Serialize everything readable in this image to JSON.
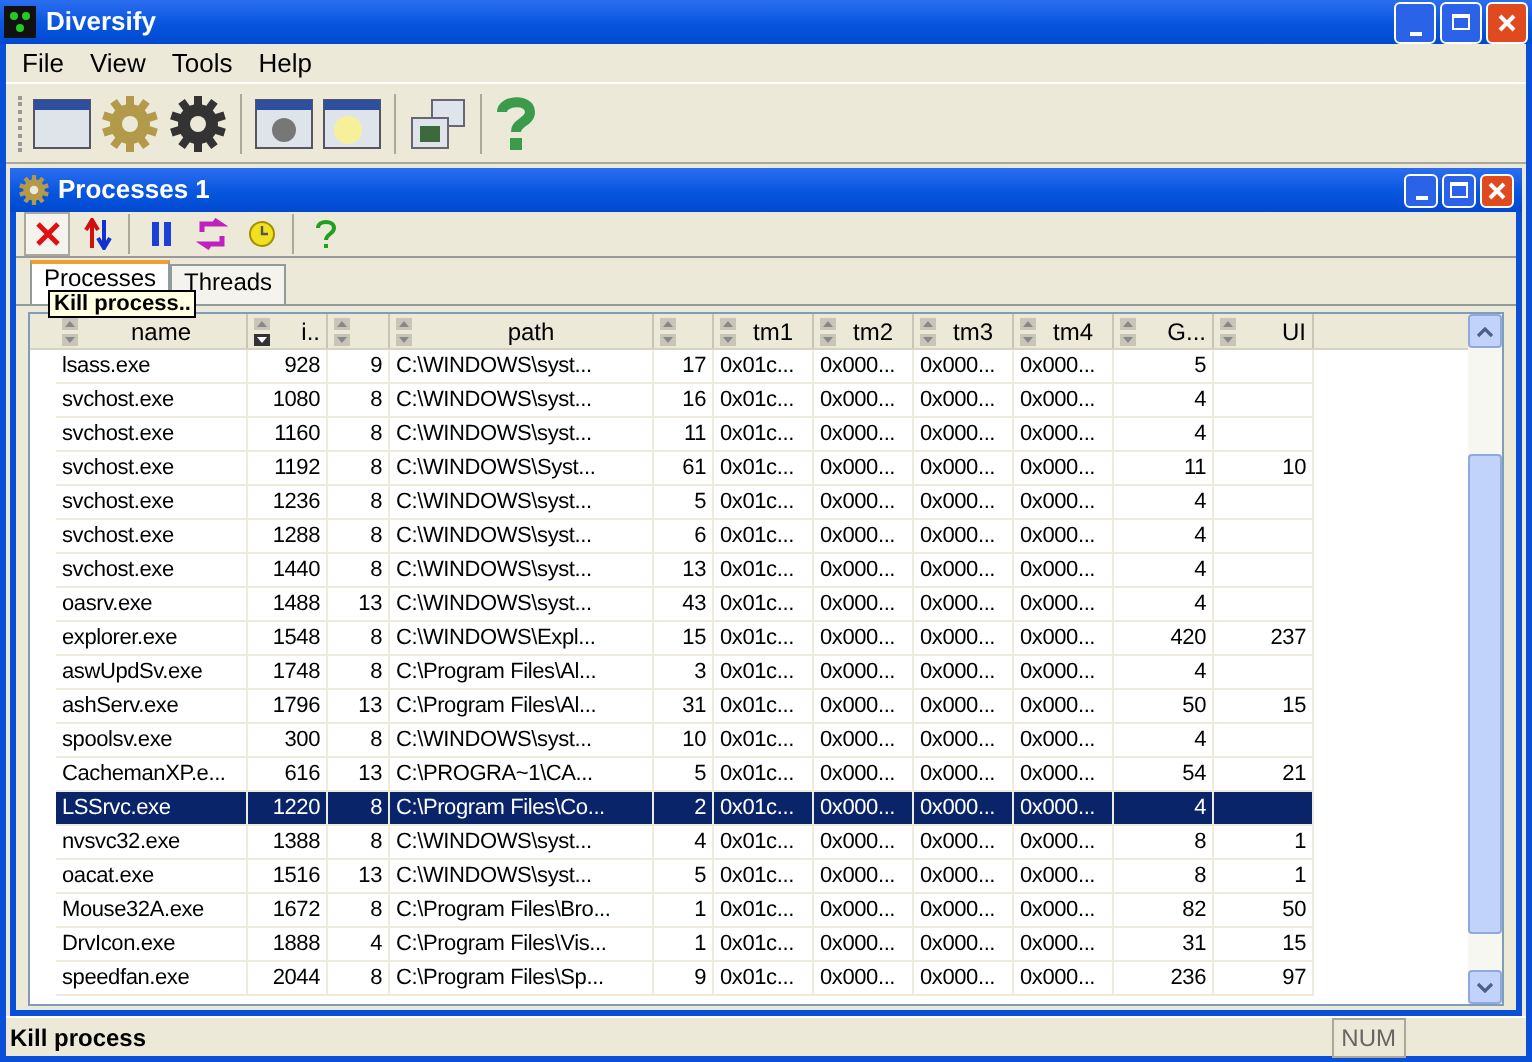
{
  "window": {
    "title": "Diversify"
  },
  "menu": [
    "File",
    "View",
    "Tools",
    "Help"
  ],
  "child_window": {
    "title": "Processes 1"
  },
  "child_toolbar": [
    {
      "kind": "kill",
      "pressed": true
    },
    {
      "kind": "priority",
      "pressed": false
    },
    {
      "kind": "pause",
      "pressed": false
    },
    {
      "kind": "refresh",
      "pressed": false
    },
    {
      "kind": "clock",
      "pressed": false
    },
    {
      "kind": "help",
      "pressed": false
    }
  ],
  "tabs": [
    {
      "label": "Processes",
      "selected": true
    },
    {
      "label": "Threads",
      "selected": false
    }
  ],
  "tooltip": "Kill process..",
  "table": {
    "columns": [
      {
        "label": "name",
        "sorted": false
      },
      {
        "label": "i..",
        "sorted": true
      },
      {
        "sorted": false
      },
      {
        "label": "path",
        "sorted": false
      },
      {
        "sorted": false
      },
      {
        "label": "tm1",
        "sorted": false
      },
      {
        "label": "tm2",
        "sorted": false
      },
      {
        "label": "tm3",
        "sorted": false
      },
      {
        "label": "tm4",
        "sorted": false
      },
      {
        "label": "G...",
        "sorted": false
      },
      {
        "label": "UI",
        "sorted": false
      }
    ],
    "rows": [
      {
        "cells": [
          "lsass.exe",
          "928",
          "9",
          "C:\\WINDOWS\\syst...",
          "17",
          "0x01c...",
          "0x000...",
          "0x000...",
          "0x000...",
          "5"
        ],
        "selected": false
      },
      {
        "cells": [
          "svchost.exe",
          "1080",
          "8",
          "C:\\WINDOWS\\syst...",
          "16",
          "0x01c...",
          "0x000...",
          "0x000...",
          "0x000...",
          "4"
        ],
        "selected": false
      },
      {
        "cells": [
          "svchost.exe",
          "1160",
          "8",
          "C:\\WINDOWS\\syst...",
          "11",
          "0x01c...",
          "0x000...",
          "0x000...",
          "0x000...",
          "4"
        ],
        "selected": false
      },
      {
        "cells": [
          "svchost.exe",
          "1192",
          "8",
          "C:\\WINDOWS\\Syst...",
          "61",
          "0x01c...",
          "0x000...",
          "0x000...",
          "0x000...",
          "11",
          "10"
        ],
        "selected": false
      },
      {
        "cells": [
          "svchost.exe",
          "1236",
          "8",
          "C:\\WINDOWS\\syst...",
          "5",
          "0x01c...",
          "0x000...",
          "0x000...",
          "0x000...",
          "4"
        ],
        "selected": false
      },
      {
        "cells": [
          "svchost.exe",
          "1288",
          "8",
          "C:\\WINDOWS\\syst...",
          "6",
          "0x01c...",
          "0x000...",
          "0x000...",
          "0x000...",
          "4"
        ],
        "selected": false
      },
      {
        "cells": [
          "svchost.exe",
          "1440",
          "8",
          "C:\\WINDOWS\\syst...",
          "13",
          "0x01c...",
          "0x000...",
          "0x000...",
          "0x000...",
          "4"
        ],
        "selected": false
      },
      {
        "cells": [
          "oasrv.exe",
          "1488",
          "13",
          "C:\\WINDOWS\\syst...",
          "43",
          "0x01c...",
          "0x000...",
          "0x000...",
          "0x000...",
          "4"
        ],
        "selected": false
      },
      {
        "cells": [
          "explorer.exe",
          "1548",
          "8",
          "C:\\WINDOWS\\Expl...",
          "15",
          "0x01c...",
          "0x000...",
          "0x000...",
          "0x000...",
          "420",
          "237"
        ],
        "selected": false
      },
      {
        "cells": [
          "aswUpdSv.exe",
          "1748",
          "8",
          "C:\\Program Files\\Al...",
          "3",
          "0x01c...",
          "0x000...",
          "0x000...",
          "0x000...",
          "4"
        ],
        "selected": false
      },
      {
        "cells": [
          "ashServ.exe",
          "1796",
          "13",
          "C:\\Program Files\\Al...",
          "31",
          "0x01c...",
          "0x000...",
          "0x000...",
          "0x000...",
          "50",
          "15"
        ],
        "selected": false
      },
      {
        "cells": [
          "spoolsv.exe",
          "300",
          "8",
          "C:\\WINDOWS\\syst...",
          "10",
          "0x01c...",
          "0x000...",
          "0x000...",
          "0x000...",
          "4"
        ],
        "selected": false
      },
      {
        "cells": [
          "CachemanXP.e...",
          "616",
          "13",
          "C:\\PROGRA~1\\CA...",
          "5",
          "0x01c...",
          "0x000...",
          "0x000...",
          "0x000...",
          "54",
          "21"
        ],
        "selected": false
      },
      {
        "cells": [
          "LSSrvc.exe",
          "1220",
          "8",
          "C:\\Program Files\\Co...",
          "2",
          "0x01c...",
          "0x000...",
          "0x000...",
          "0x000...",
          "4"
        ],
        "selected": true
      },
      {
        "cells": [
          "nvsvc32.exe",
          "1388",
          "8",
          "C:\\WINDOWS\\syst...",
          "4",
          "0x01c...",
          "0x000...",
          "0x000...",
          "0x000...",
          "8",
          "1"
        ],
        "selected": false
      },
      {
        "cells": [
          "oacat.exe",
          "1516",
          "13",
          "C:\\WINDOWS\\syst...",
          "5",
          "0x01c...",
          "0x000...",
          "0x000...",
          "0x000...",
          "8",
          "1"
        ],
        "selected": false
      },
      {
        "cells": [
          "Mouse32A.exe",
          "1672",
          "8",
          "C:\\Program Files\\Bro...",
          "1",
          "0x01c...",
          "0x000...",
          "0x000...",
          "0x000...",
          "82",
          "50"
        ],
        "selected": false
      },
      {
        "cells": [
          "DrvIcon.exe",
          "1888",
          "4",
          "C:\\Program Files\\Vis...",
          "1",
          "0x01c...",
          "0x000...",
          "0x000...",
          "0x000...",
          "31",
          "15"
        ],
        "selected": false
      },
      {
        "cells": [
          "speedfan.exe",
          "2044",
          "8",
          "C:\\Program Files\\Sp...",
          "9",
          "0x01c...",
          "0x000...",
          "0x000...",
          "0x000...",
          "236",
          "97"
        ],
        "selected": false
      }
    ]
  },
  "status_bar": {
    "message": "Kill process",
    "indicator": "NUM"
  }
}
